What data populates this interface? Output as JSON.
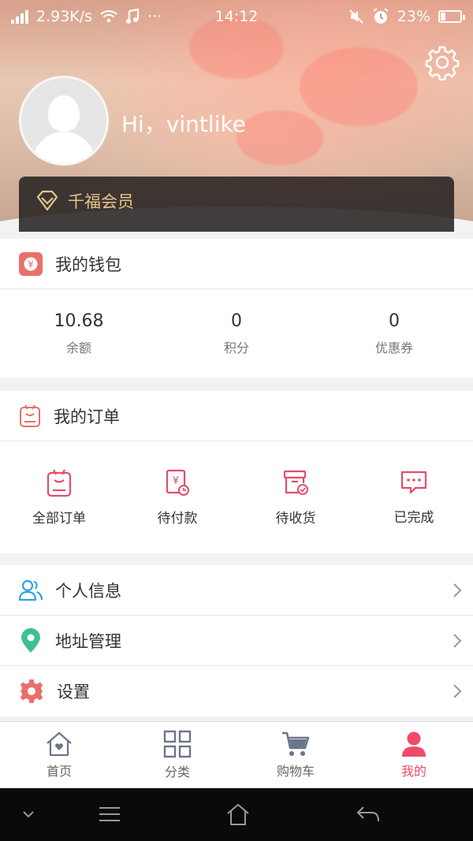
{
  "status_bar": {
    "speed": "2.93K/s",
    "time": "14:12",
    "battery": "23%"
  },
  "profile": {
    "greeting": "Hi，vintlike",
    "member_label": "千福会员"
  },
  "wallet": {
    "title": "我的钱包",
    "stats": [
      {
        "value": "10.68",
        "label": "余额"
      },
      {
        "value": "0",
        "label": "积分"
      },
      {
        "value": "0",
        "label": "优惠券"
      }
    ]
  },
  "orders": {
    "title": "我的订单",
    "items": [
      {
        "label": "全部订单",
        "icon": "all-orders-icon"
      },
      {
        "label": "待付款",
        "icon": "pending-payment-icon"
      },
      {
        "label": "待收货",
        "icon": "pending-receipt-icon"
      },
      {
        "label": "已完成",
        "icon": "completed-icon"
      }
    ]
  },
  "menu": [
    {
      "label": "个人信息",
      "icon": "people-icon"
    },
    {
      "label": "地址管理",
      "icon": "location-pin-icon"
    },
    {
      "label": "设置",
      "icon": "gear-icon"
    }
  ],
  "tabbar": [
    {
      "label": "首页",
      "icon": "home-icon"
    },
    {
      "label": "分类",
      "icon": "grid-icon"
    },
    {
      "label": "购物车",
      "icon": "cart-icon"
    },
    {
      "label": "我的",
      "icon": "user-icon"
    }
  ],
  "colors": {
    "accent": "#f04a6a",
    "wallet_icon": "#e8706a",
    "member_gold": "#e6c58a",
    "people_icon": "#2aa4e8",
    "location_icon": "#3cc18f",
    "settings_icon": "#e8706a",
    "tab_inactive": "#6a7588"
  }
}
